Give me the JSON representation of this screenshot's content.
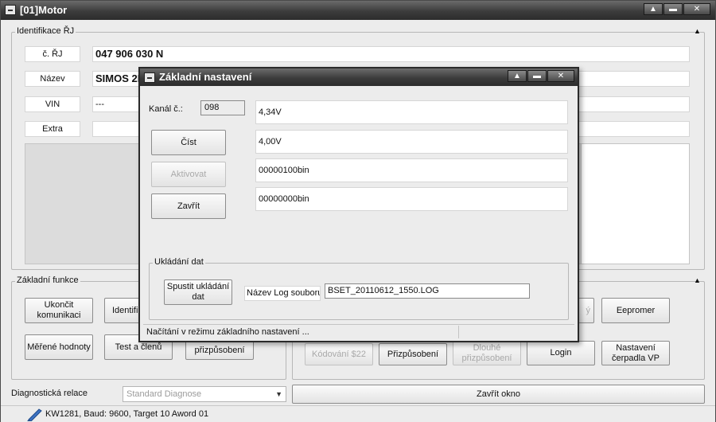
{
  "window": {
    "title": "[01]Motor"
  },
  "window_buttons": {
    "minimize": "▲",
    "restore": "▬",
    "close": "✕"
  },
  "identification": {
    "group_label": "Identifikace ŘJ",
    "rows": [
      {
        "label": "č. ŘJ",
        "value": "047 906 030 N"
      },
      {
        "label": "Název",
        "value": "SIMOS 2P"
      },
      {
        "label": "VIN",
        "value": "---"
      },
      {
        "label": "Extra",
        "value": ""
      }
    ]
  },
  "functions": {
    "group_label": "Základní funkce",
    "buttons": {
      "end_comm": "Ukončit komunikaci",
      "ident": "Identifik",
      "measured": "Měřené hodnoty",
      "test": "Test a členů",
      "adaptation_partial": "přizpůsobení",
      "eeprom": "Eepromer",
      "coding22": "Kódování $22",
      "adaptation": "Přizpůsobení",
      "long_adapt": "Dlouhé přizpůsobení",
      "login": "Login",
      "pump": "Nastavení čerpadla VP",
      "hidden_right": "ý"
    }
  },
  "session": {
    "label": "Diagnostická relace",
    "select_value": "Standard Diagnose",
    "close_button": "Zavřít okno"
  },
  "status": {
    "text": "KW1281, Baud: 9600, Target 10 Aword 01"
  },
  "dialog": {
    "title": "Základní nastavení",
    "channel_label": "Kanál č.:",
    "channel_value": "098",
    "read_button": "Číst",
    "activate_button": "Aktivovat",
    "close_button": "Zavřít",
    "values": [
      "4,34V",
      "4,00V",
      "00000100bin",
      "00000000bin"
    ],
    "save_group": {
      "label": "Ukládání dat",
      "start_button": "Spustit ukládání dat",
      "log_label": "Název Log souboru",
      "log_value": "BSET_20110612_1550.LOG"
    },
    "status": "Načítání v režimu základního nastavení ..."
  }
}
